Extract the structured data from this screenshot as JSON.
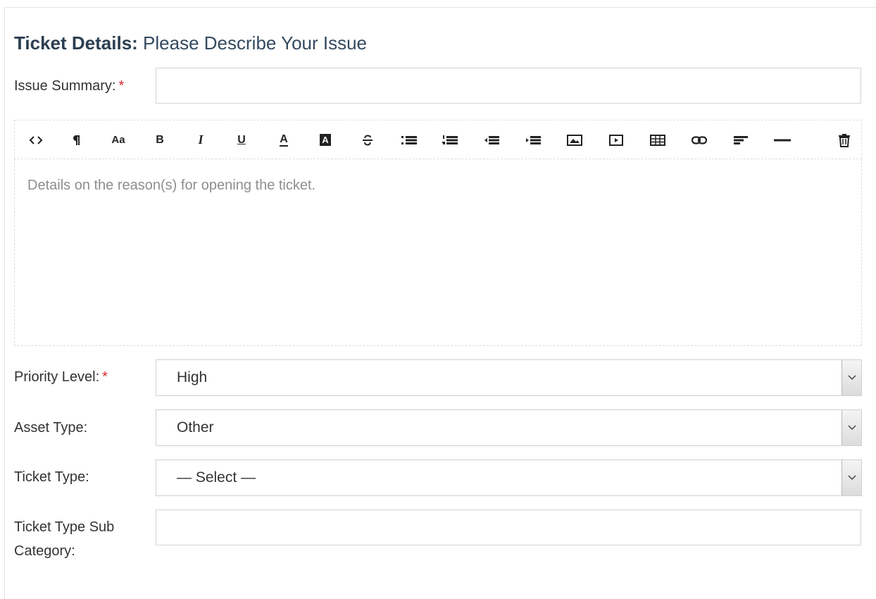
{
  "form": {
    "heading_bold": "Ticket Details:",
    "heading_rest": " Please Describe Your Issue",
    "required_mark": "*",
    "issue_summary": {
      "label": "Issue Summary:",
      "value": ""
    },
    "details": {
      "placeholder": "Details on the reason(s) for opening the ticket."
    },
    "priority": {
      "label": "Priority Level:",
      "value": "High"
    },
    "asset_type": {
      "label": "Asset Type:",
      "value": "Other"
    },
    "ticket_type": {
      "label": "Ticket Type:",
      "value": "— Select —"
    },
    "sub_category": {
      "label_line1": "Ticket Type Sub",
      "label_line2": "Category:",
      "value": ""
    }
  },
  "toolbar": {
    "font_size_label": "Aa",
    "bold_label": "B",
    "italic_label": "I",
    "underline_label": "U",
    "font_color_label": "A",
    "highlight_label": "A",
    "icons": [
      "code-view-icon",
      "paragraph-icon",
      "font-size-icon",
      "bold-icon",
      "italic-icon",
      "underline-icon",
      "font-color-icon",
      "highlight-color-icon",
      "strikethrough-icon",
      "unordered-list-icon",
      "ordered-list-icon",
      "outdent-icon",
      "indent-icon",
      "image-icon",
      "video-icon",
      "table-icon",
      "link-icon",
      "align-left-icon",
      "horizontal-rule-icon",
      "trash-icon"
    ]
  }
}
